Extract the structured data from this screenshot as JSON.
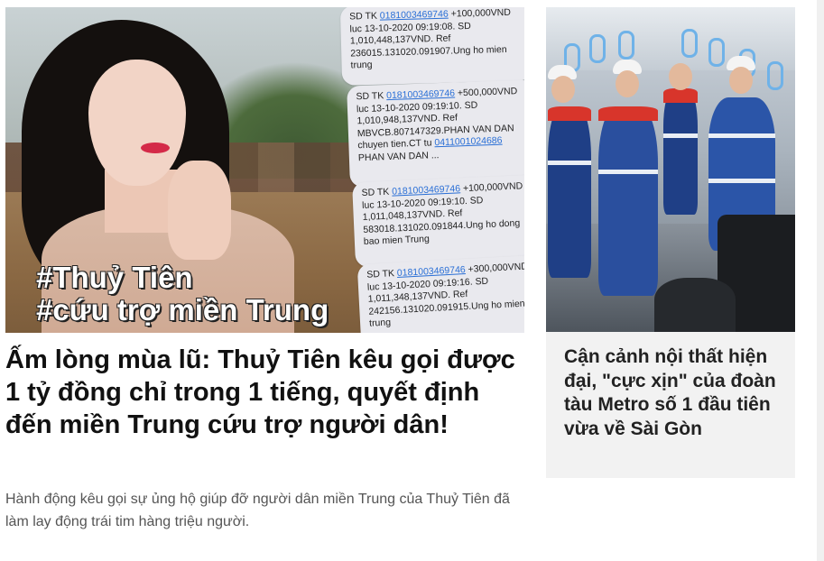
{
  "main_article": {
    "hero": {
      "hashtag_1": "#Thuỷ Tiên",
      "hashtag_2": "#cứu trợ miền Trung",
      "sms": [
        {
          "prefix": "SD TK ",
          "account": "0181003469746",
          "body": "+100,000VND luc 13-10-2020 09:19:08. SD 1,010,448,137VND. Ref 236015.131020.091907.Ung ho mien trung"
        },
        {
          "prefix": "SD TK ",
          "account": "0181003469746",
          "body_1": "+500,000VND luc 13-10-2020 09:19:10. SD 1,010,948,137VND. Ref MBVCB.807147329.PHAN VAN DAN chuyen tien.CT tu ",
          "link": "0411001024686",
          "body_2": " PHAN VAN DAN ..."
        },
        {
          "prefix": "SD TK ",
          "account": "0181003469746",
          "body": "+100,000VND luc 13-10-2020 09:19:10. SD 1,011,048,137VND. Ref 583018.131020.091844.Ung ho dong bao mien Trung"
        },
        {
          "prefix": "SD TK ",
          "account": "0181003469746",
          "body": "+300,000VND luc 13-10-2020 09:19:16. SD 1,011,348,137VND. Ref 242156.131020.091915.Ung ho mien trung"
        }
      ]
    },
    "title": "Ấm lòng mùa lũ: Thuỷ Tiên kêu gọi được 1 tỷ đồng chỉ trong 1 tiếng, quyết định đến miền Trung cứu trợ người dân!",
    "description": "Hành động kêu gọi sự ủng hộ giúp đỡ người dân miền Trung của Thuỷ Tiên đã làm lay động trái tim hàng triệu người."
  },
  "side_article": {
    "title": "Cận cảnh nội thất hiện đại, \"cực xịn\" của đoàn tàu Metro số 1 đầu tiên vừa về Sài Gòn"
  },
  "colors": {
    "title_text": "#111111",
    "description_text": "#555555",
    "side_card_bg": "#f2f2f2",
    "hashtag_text": "#ffffff",
    "sms_link": "#2a6fd6"
  }
}
